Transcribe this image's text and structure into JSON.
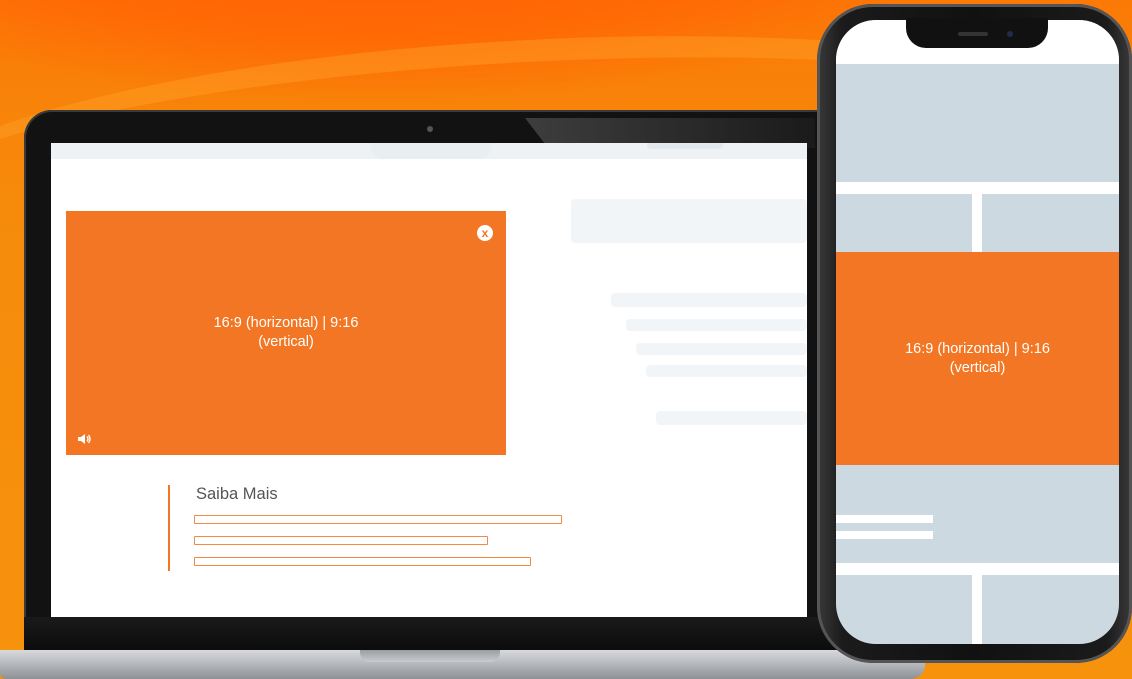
{
  "ad": {
    "caption": "16:9 (horizontal) | 9:16\n(vertical)",
    "accent_color": "#f27623"
  },
  "icons": {
    "close": "close-icon",
    "volume": "volume-icon"
  },
  "close_glyph": "x",
  "learn_more": {
    "title": "Saiba Mais"
  },
  "mobile_ad": {
    "caption": "16:9 (horizontal) | 9:16\n(vertical)"
  }
}
